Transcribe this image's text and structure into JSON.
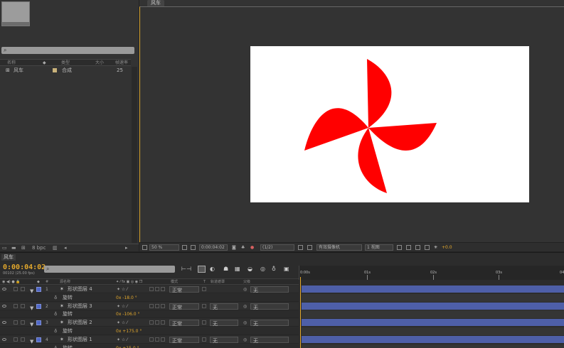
{
  "project": {
    "search_icon": "⌕",
    "columns": [
      "名称",
      "类型",
      "大小",
      "帧速率"
    ],
    "items": [
      {
        "name": "风车",
        "type": "合成",
        "fps": "25"
      }
    ],
    "bpc": "8 bpc"
  },
  "viewer": {
    "tab": "风车",
    "zoom": "50 %",
    "timecode": "0:00:04:02",
    "resolution": "(1/2)",
    "camera": "有效摄像机",
    "views": "1 视图",
    "exposure": "+0.0"
  },
  "timeline": {
    "tab": "风车",
    "timecode": "0:00:04:02",
    "frames": "00102 (25.00 fps)",
    "search_icon": "⌕",
    "col_name": "源名称",
    "col_mode": "模式",
    "col_t": "T",
    "col_trkmat": "轨道遮罩",
    "col_parent": "父级",
    "ruler": [
      "0:00s",
      "01s",
      "02s",
      "03s",
      "04"
    ],
    "layers": [
      {
        "num": "1",
        "name": "形状图层 4",
        "mode": "正常",
        "trkmat": "",
        "parent": "无",
        "sub": "旋转",
        "rot": "0x -18.0 °"
      },
      {
        "num": "2",
        "name": "形状图层 3",
        "mode": "正常",
        "trkmat": "无",
        "parent": "无",
        "sub": "旋转",
        "rot": "0x -106.0 °"
      },
      {
        "num": "3",
        "name": "形状图层 2",
        "mode": "正常",
        "trkmat": "无",
        "parent": "无",
        "sub": "旋转",
        "rot": "0x +175.0 °"
      },
      {
        "num": "4",
        "name": "形状图层 1",
        "mode": "正常",
        "trkmat": "无",
        "parent": "无",
        "sub": "旋转",
        "rot": "0x +15.0 °"
      }
    ]
  },
  "colors": {
    "accent": "#e3a82c",
    "layer_label": "#5068c8",
    "windmill": "#ff0000"
  }
}
